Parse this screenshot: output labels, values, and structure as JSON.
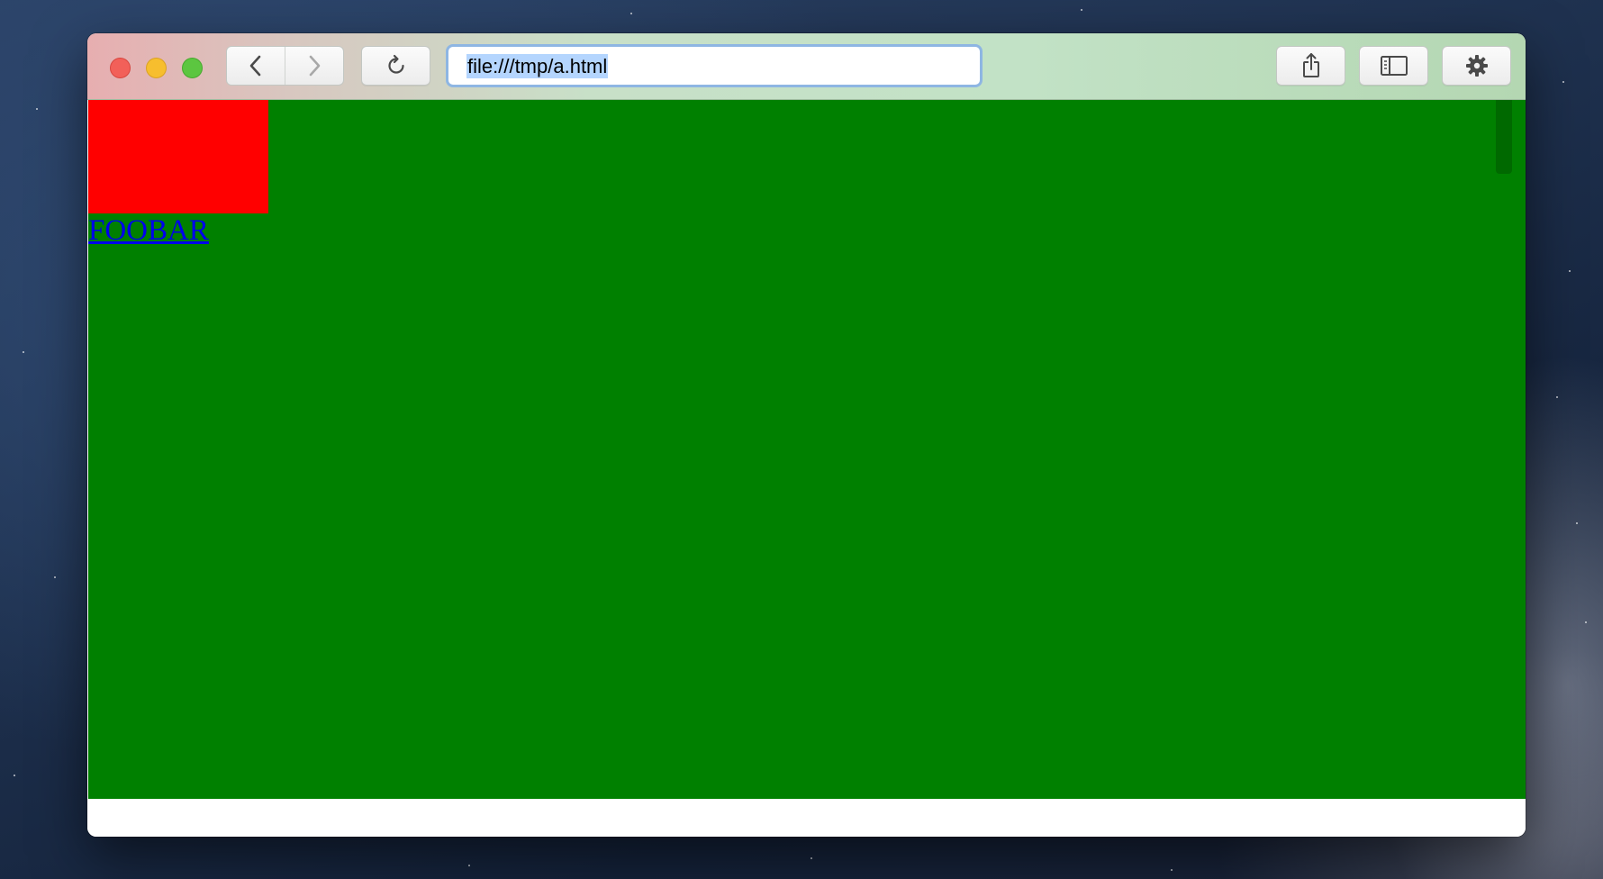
{
  "browser": {
    "address_bar": {
      "url": "file:///tmp/a.html"
    },
    "icons": {
      "back": "chevron-left-icon",
      "forward": "chevron-right-icon",
      "reload": "reload-icon",
      "share": "share-icon",
      "sidebar": "sidebar-icon",
      "settings": "gear-icon"
    }
  },
  "page": {
    "link_text": "FOOBAR",
    "colors": {
      "background": "#008000",
      "box": "#ff0000",
      "link": "#0000ee"
    }
  }
}
